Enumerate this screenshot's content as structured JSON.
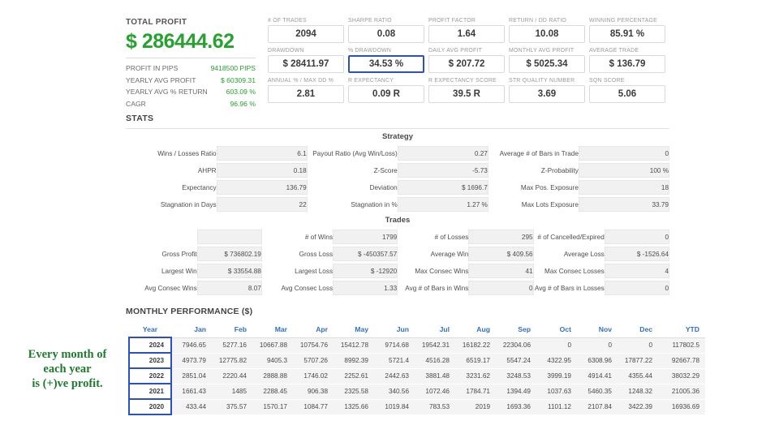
{
  "annotation": {
    "line1": "Every month of",
    "line2": "each year",
    "line3": "is (+)ve profit.",
    "color": "#1f7a2e"
  },
  "summary": {
    "total_profit_label": "TOTAL PROFIT",
    "total_profit_value": "$ 286444.62",
    "rows": [
      {
        "label": "PROFIT IN PIPS",
        "value": "9418500 PIPS"
      },
      {
        "label": "YEARLY AVG PROFIT",
        "value": "$ 60309.31"
      },
      {
        "label": "YEARLY AVG % RETURN",
        "value": "603.09 %"
      },
      {
        "label": "CAGR",
        "value": "96.96 %"
      }
    ],
    "stats_heading": "STATS",
    "accent_green": "#27a12f"
  },
  "metric_cards": [
    {
      "label": "# OF TRADES",
      "value": "2094",
      "highlight": false
    },
    {
      "label": "SHARPE RATIO",
      "value": "0.08",
      "highlight": false
    },
    {
      "label": "PROFIT FACTOR",
      "value": "1.64",
      "highlight": false
    },
    {
      "label": "RETURN / DD RATIO",
      "value": "10.08",
      "highlight": false
    },
    {
      "label": "WINNING PERCENTAGE",
      "value": "85.91 %",
      "highlight": false
    },
    {
      "label": "DRAWDOWN",
      "value": "$ 28411.97",
      "highlight": false
    },
    {
      "label": "% DRAWDOWN",
      "value": "34.53 %",
      "highlight": true
    },
    {
      "label": "DAILY AVG PROFIT",
      "value": "$ 207.72",
      "highlight": false
    },
    {
      "label": "MONTHLY AVG PROFIT",
      "value": "$ 5025.34",
      "highlight": false
    },
    {
      "label": "AVERAGE TRADE",
      "value": "$ 136.79",
      "highlight": false
    },
    {
      "label": "ANNUAL % / MAX DD %",
      "value": "2.81",
      "highlight": false
    },
    {
      "label": "R EXPECTANCY",
      "value": "0.09 R",
      "highlight": false
    },
    {
      "label": "R EXPECTANCY SCORE",
      "value": "39.5 R",
      "highlight": false
    },
    {
      "label": "STR QUALITY NUMBER",
      "value": "3.69",
      "highlight": false
    },
    {
      "label": "SQN SCORE",
      "value": "5.06",
      "highlight": false
    }
  ],
  "strategy": {
    "title": "Strategy",
    "rows": [
      [
        {
          "label": "Wins / Losses Ratio",
          "value": "6.1"
        },
        {
          "label": "Payout Ratio (Avg Win/Loss)",
          "value": "0.27"
        },
        {
          "label": "Average # of Bars in Trade",
          "value": "0"
        }
      ],
      [
        {
          "label": "AHPR",
          "value": "0.18"
        },
        {
          "label": "Z-Score",
          "value": "-5.73"
        },
        {
          "label": "Z-Probability",
          "value": "100 %"
        }
      ],
      [
        {
          "label": "Expectancy",
          "value": "136.79"
        },
        {
          "label": "Deviation",
          "value": "$ 1696.7"
        },
        {
          "label": "Max Pos. Exposure",
          "value": "18"
        }
      ],
      [
        {
          "label": "Stagnation in Days",
          "value": "22"
        },
        {
          "label": "Stagnation in %",
          "value": "1.27 %"
        },
        {
          "label": "Max Lots Exposure",
          "value": "33.79"
        }
      ]
    ]
  },
  "trades": {
    "title": "Trades",
    "rows": [
      [
        {
          "label": "",
          "value": ""
        },
        {
          "label": "# of Wins",
          "value": "1799"
        },
        {
          "label": "# of Losses",
          "value": "295"
        },
        {
          "label": "# of Cancelled/Expired",
          "value": "0"
        }
      ],
      [
        {
          "label": "Gross Profit",
          "value": "$ 736802.19"
        },
        {
          "label": "Gross Loss",
          "value": "$ -450357.57"
        },
        {
          "label": "Average Win",
          "value": "$ 409.56"
        },
        {
          "label": "Average Loss",
          "value": "$ -1526.64"
        }
      ],
      [
        {
          "label": "Largest Win",
          "value": "$ 33554.88"
        },
        {
          "label": "Largest Loss",
          "value": "$ -12920"
        },
        {
          "label": "Max Consec Wins",
          "value": "41"
        },
        {
          "label": "Max Consec Losses",
          "value": "4"
        }
      ],
      [
        {
          "label": "Avg Consec Wins",
          "value": "8.07"
        },
        {
          "label": "Avg Consec Loss",
          "value": "1.33"
        },
        {
          "label": "Avg # of Bars in Wins",
          "value": "0"
        },
        {
          "label": "Avg # of Bars in Losses",
          "value": "0"
        }
      ]
    ]
  },
  "monthly_performance": {
    "title": "MONTHLY PERFORMANCE ($)",
    "columns": [
      "Year",
      "Jan",
      "Feb",
      "Mar",
      "Apr",
      "May",
      "Jun",
      "Jul",
      "Aug",
      "Sep",
      "Oct",
      "Nov",
      "Dec",
      "YTD"
    ],
    "rows": [
      {
        "year": "2024",
        "values": [
          "7946.65",
          "5277.16",
          "10667.88",
          "10754.76",
          "15412.78",
          "9714.68",
          "19542.31",
          "16182.22",
          "22304.06",
          "0",
          "0",
          "0",
          "117802.5"
        ]
      },
      {
        "year": "2023",
        "values": [
          "4973.79",
          "12775.82",
          "9405.3",
          "5707.26",
          "8992.39",
          "5721.4",
          "4516.28",
          "6519.17",
          "5547.24",
          "4322.95",
          "6308.96",
          "17877.22",
          "92667.78"
        ]
      },
      {
        "year": "2022",
        "values": [
          "2851.04",
          "2220.44",
          "2888.88",
          "1746.02",
          "2252.61",
          "2442.63",
          "3881.48",
          "3231.62",
          "3248.53",
          "3999.19",
          "4914.41",
          "4355.44",
          "38032.29"
        ]
      },
      {
        "year": "2021",
        "values": [
          "1661.43",
          "1485",
          "2288.45",
          "906.38",
          "2325.58",
          "340.56",
          "1072.46",
          "1784.71",
          "1394.49",
          "1037.63",
          "5460.35",
          "1248.32",
          "21005.36"
        ]
      },
      {
        "year": "2020",
        "values": [
          "433.44",
          "375.57",
          "1570.17",
          "1084.77",
          "1325.66",
          "1019.84",
          "783.53",
          "2019",
          "1693.36",
          "1101.12",
          "2107.84",
          "3422.39",
          "16936.69"
        ]
      }
    ],
    "header_color": "#2f6fc4",
    "year_box_color": "#2c4fc7"
  }
}
